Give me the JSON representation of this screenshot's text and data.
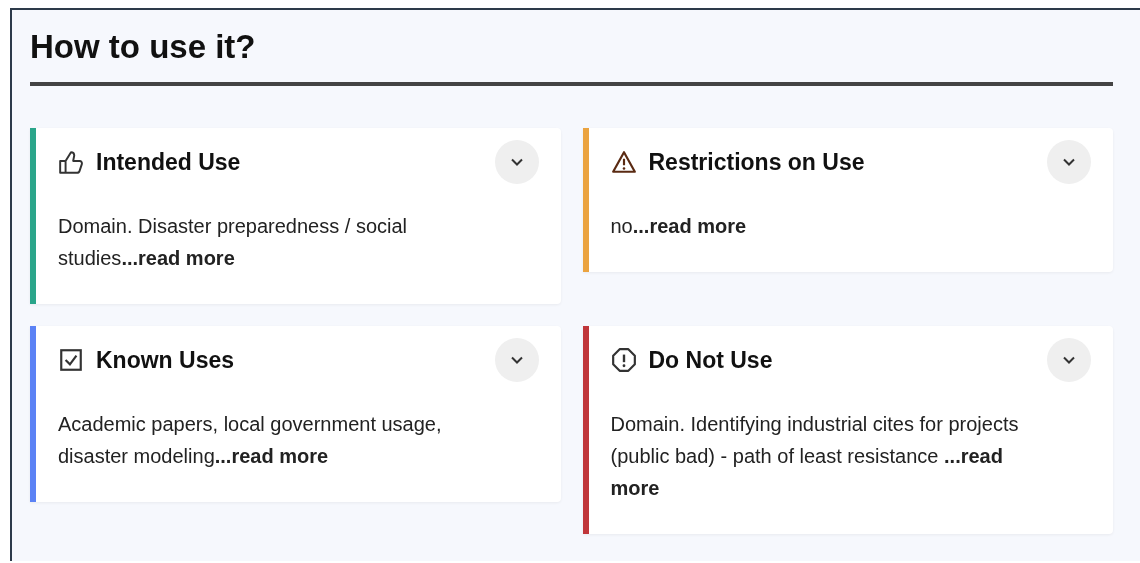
{
  "section": {
    "title": "How to use it?"
  },
  "cards": [
    {
      "kind": "intended",
      "title": "Intended Use",
      "color": "#2aa58a",
      "expanded": false,
      "text": "Domain. Disaster preparedness / social studies**...read more**"
    },
    {
      "kind": "restricted",
      "title": "Restrictions on Use",
      "color": "#eba33f",
      "expanded": false,
      "text": "no**...read more**"
    },
    {
      "kind": "known",
      "title": "Known Uses",
      "color": "#5b82f5",
      "expanded": false,
      "text": "Academic papers, local government usage, disaster modeling**...read more**"
    },
    {
      "kind": "prohibited",
      "title": "Do Not Use",
      "color": "#c0363a",
      "expanded": false,
      "text": "Domain. Identifying industrial cites for projects (public bad) - path of least resistance **...read more**"
    }
  ]
}
